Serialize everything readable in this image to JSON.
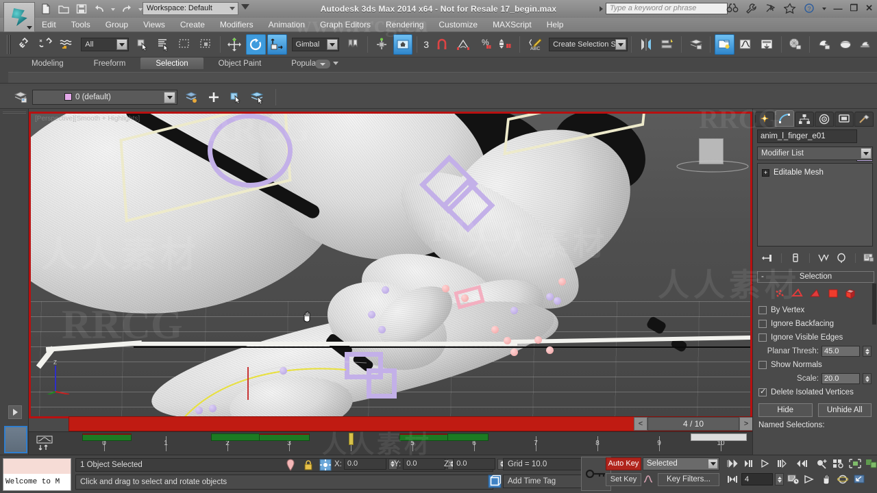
{
  "titlebar": {
    "app_title": "Autodesk 3ds Max  2014 x64  - Not for Resale   17_begin.max",
    "workspace": "Workspace: Default",
    "search_placeholder": "Type a keyword or phrase",
    "minimize": "—",
    "maximize": "❐",
    "close": "✕",
    "icons": [
      "new-file-icon",
      "open-file-icon",
      "save-icon",
      "undo-icon",
      "redo-icon",
      "project-folder-icon"
    ],
    "right_icons": [
      "binoculars-icon",
      "wrench-icon",
      "satellite-icon",
      "star-icon",
      "help-icon"
    ]
  },
  "menubar": {
    "items": [
      "Edit",
      "Tools",
      "Group",
      "Views",
      "Create",
      "Modifiers",
      "Animation",
      "Graph Editors",
      "Rendering",
      "Customize",
      "MAXScript",
      "Help"
    ]
  },
  "toolbar": {
    "selection_filter": "All",
    "reference_coord": "Gimbal",
    "named_selection_sets": "Create Selection Se",
    "angle_snap_value": "3",
    "icons": [
      "select-and-link-icon",
      "unlink-selection-icon",
      "bind-to-space-warp-icon",
      "select-object-icon",
      "select-by-name-icon",
      "rectangular-region-icon",
      "window-crossing-icon",
      "select-and-move-icon",
      "select-and-rotate-icon",
      "select-and-scale-icon",
      "use-pivot-center-icon",
      "use-selection-center-icon",
      "snaps-toggle-icon",
      "angle-snap-icon",
      "percent-snap-icon",
      "spinner-snap-icon",
      "edit-named-selection-icon",
      "mirror-icon",
      "align-icon",
      "layer-manager-icon",
      "graphite-modeling-icon",
      "curve-editor-icon",
      "schematic-view-icon",
      "material-editor-icon",
      "render-setup-icon",
      "rendered-frame-icon",
      "render-production-icon"
    ]
  },
  "ribbon": {
    "tabs": [
      "Modeling",
      "Freeform",
      "Selection",
      "Object Paint",
      "Populate"
    ],
    "selected_tab": "Selection"
  },
  "layerbar": {
    "current_layer": "0 (default)",
    "layer_swatch_color": "#e3a8e8",
    "icons": [
      "layer-manager-icon",
      "layer-explorer-icon",
      "add-layer-icon",
      "select-objects-in-layer-icon",
      "set-current-layer-icon"
    ]
  },
  "viewport": {
    "label": "[Perspective][Smooth + Highlights]",
    "border_color": "#b81010",
    "cursor": "pan-hand-cursor",
    "helper_color": "#c3b0e8",
    "bone_color": "#edeacb"
  },
  "timeslider": {
    "current_frame_label": "4 / 10",
    "prev_label": "<",
    "next_label": ">",
    "bar_color": "#c01b12"
  },
  "trackbar": {
    "ticks": [
      "0",
      "1",
      "2",
      "3",
      "4",
      "5",
      "6",
      "7",
      "8",
      "9",
      "10"
    ],
    "current_key": "4",
    "key_color": "#1c7a23",
    "current_key_color": "#d8c24a"
  },
  "command_panel": {
    "tabs": [
      "create-tab",
      "modify-tab",
      "hierarchy-tab",
      "motion-tab",
      "display-tab",
      "utilities-tab"
    ],
    "selected_tab": "modify-tab",
    "object_name": "anim_l_finger_e01",
    "object_color": "#c9b4ee",
    "modifier_list_label": "Modifier List",
    "stack": [
      {
        "label": "Editable Mesh"
      }
    ],
    "stack_buttons": [
      "pin-stack-icon",
      "show-end-result-icon",
      "make-unique-icon",
      "remove-modifier-icon",
      "configure-modifier-sets-icon"
    ],
    "rollout": {
      "title": "Selection",
      "collapse_glyph": "-",
      "subobject_levels": [
        "vertex-subobject-icon",
        "edge-subobject-icon",
        "face-subobject-icon",
        "polygon-subobject-icon",
        "element-subobject-icon"
      ],
      "checkboxes": [
        {
          "label": "By Vertex",
          "checked": false
        },
        {
          "label": "Ignore Backfacing",
          "checked": false
        },
        {
          "label": "Ignore Visible Edges",
          "checked": false
        }
      ],
      "planar_thresh_label": "Planar Thresh:",
      "planar_thresh_value": "45.0",
      "show_normals_label": "Show Normals",
      "show_normals_checked": false,
      "scale_label": "Scale:",
      "scale_value": "20.0",
      "delete_isolated_label": "Delete Isolated Vertices",
      "delete_isolated_checked": true,
      "hide_button": "Hide",
      "unhide_button": "Unhide All",
      "named_selections_label": "Named Selections:"
    }
  },
  "status": {
    "maxscript_listener_text": "Welcome to M",
    "selection_status": "1 Object Selected",
    "prompt": "Click and drag to select and rotate objects",
    "x_label": "X:",
    "x_value": "0.0",
    "y_label": "Y:",
    "y_value": "0.0",
    "z_label": "Z:",
    "z_value": "0.0",
    "grid_label": "Grid = 10.0",
    "add_time_tag": "Add Time Tag",
    "auto_key": "Auto Key",
    "set_key": "Set Key",
    "key_mode": "Selected",
    "key_filters": "Key Filters...",
    "current_frame": "4",
    "icons": [
      "isolate-selection-icon",
      "selection-lock-icon",
      "absolute-relative-icon",
      "key-toggle-icon",
      "time-tag-icon"
    ],
    "playback_icons": [
      "go-to-start-icon",
      "previous-frame-icon",
      "play-animation-icon",
      "next-frame-icon",
      "go-to-end-icon",
      "key-mode-toggle-icon"
    ],
    "viewport_nav_icons": [
      "zoom-icon",
      "zoom-all-icon",
      "zoom-extents-icon",
      "zoom-region-icon",
      "time-config-icon",
      "field-of-view-icon",
      "pan-view-icon",
      "orbit-icon",
      "maximize-viewport-icon"
    ]
  },
  "watermarks": {
    "site": "www.rrcg.cn",
    "brand": "RRCG",
    "cn": "人人素材"
  }
}
